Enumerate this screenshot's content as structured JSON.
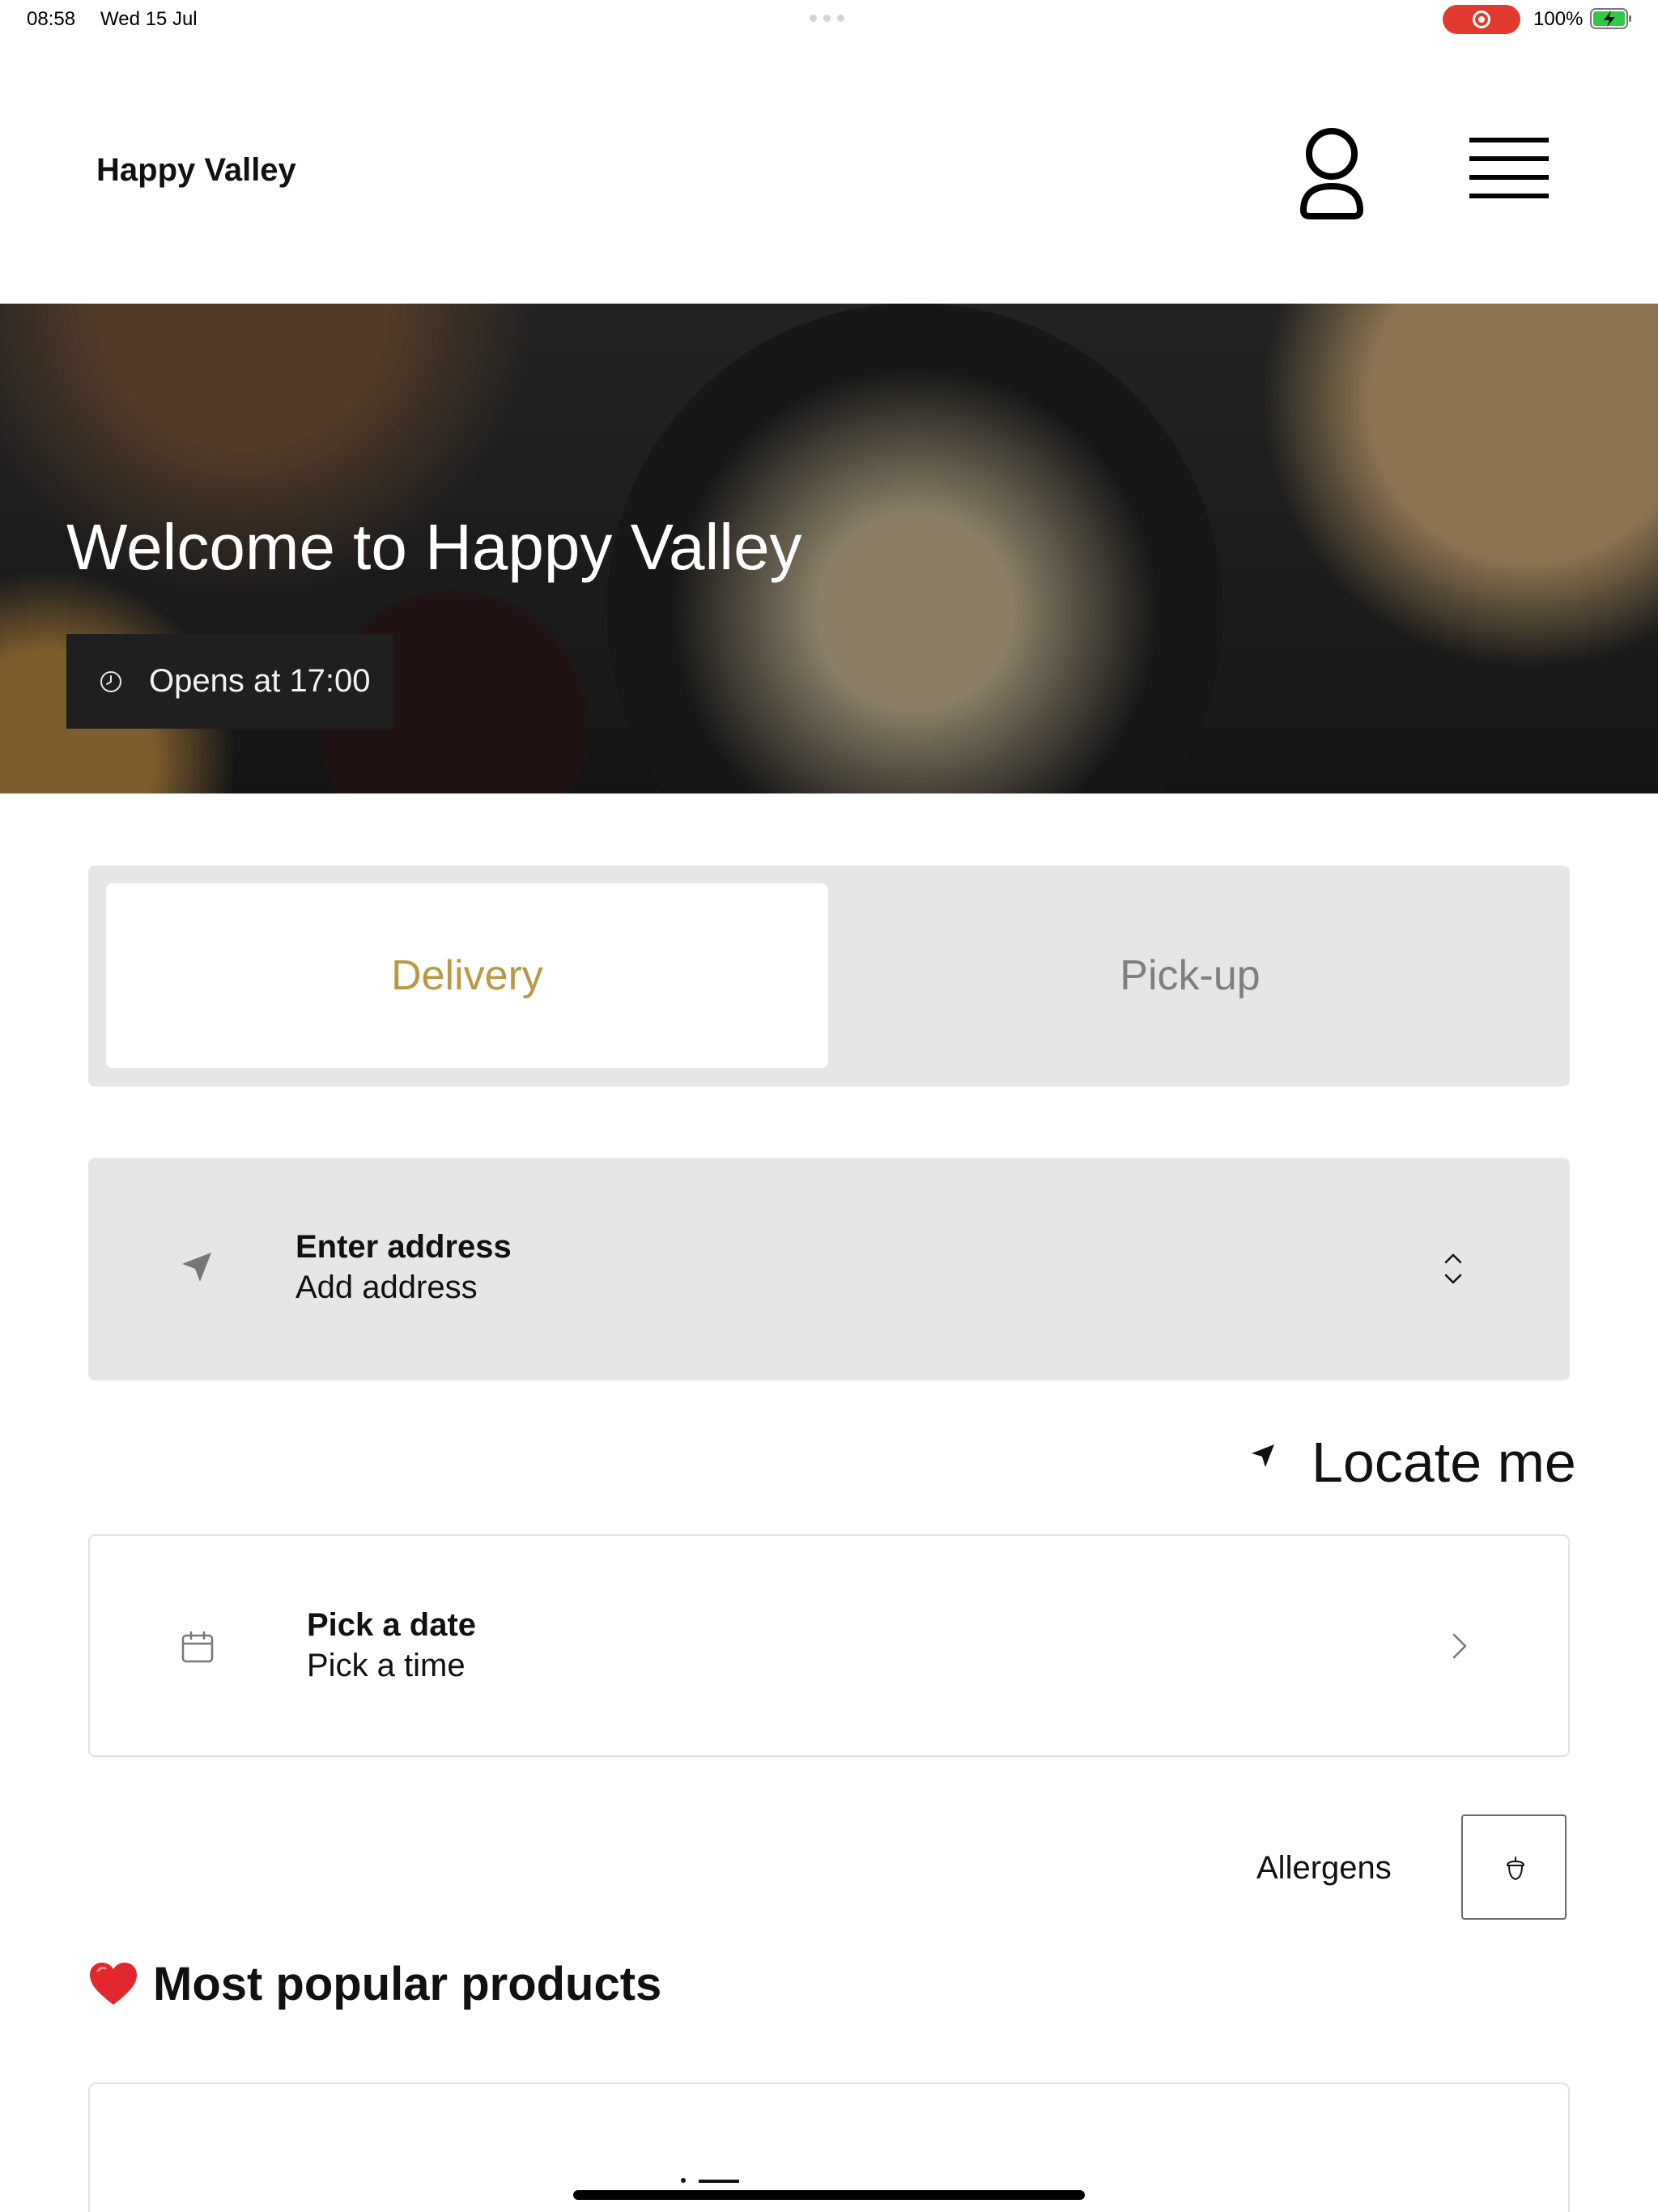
{
  "status_bar": {
    "time": "08:58",
    "date": "Wed 15 Jul",
    "battery_percent": "100%",
    "recording_color": "#e23a2e"
  },
  "header": {
    "brand": "Happy Valley",
    "user_icon": "user-icon",
    "menu_icon": "hamburger-menu-icon"
  },
  "hero": {
    "title": "Welcome to Happy Valley",
    "opens_label": "Opens at 17:00",
    "clock_icon": "clock-icon"
  },
  "order_mode": {
    "options": [
      "Delivery",
      "Pick-up"
    ],
    "selected": "Delivery",
    "accent_color": "#b69a46"
  },
  "address": {
    "title": "Enter address",
    "subtitle": "Add address",
    "icon": "navigation-arrow-icon",
    "expand_icon": "chevron-up-down-icon"
  },
  "locate": {
    "label": "Locate me",
    "icon": "location-arrow-icon"
  },
  "schedule": {
    "title": "Pick a date",
    "subtitle": "Pick a time",
    "icon": "calendar-icon",
    "chevron_icon": "chevron-right-icon"
  },
  "allergens": {
    "label": "Allergens",
    "icon": "acorn-icon"
  },
  "popular": {
    "title": "Most popular products",
    "icon": "heart-icon"
  }
}
